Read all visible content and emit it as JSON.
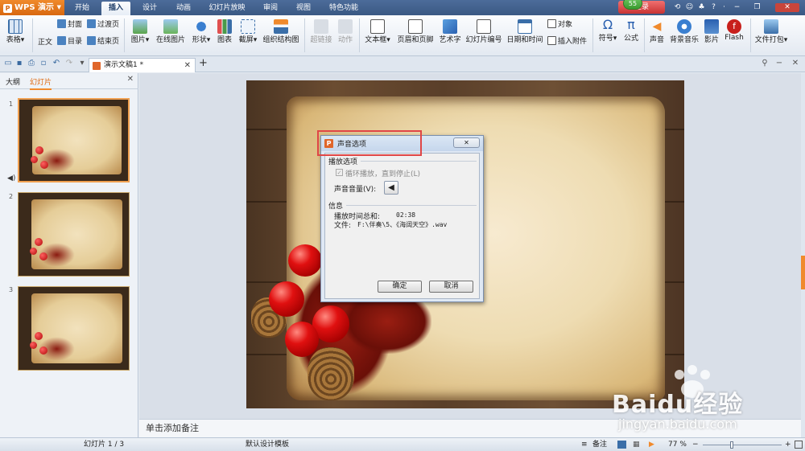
{
  "app": {
    "name": "WPS 演示"
  },
  "tabs": [
    "开始",
    "插入",
    "设计",
    "动画",
    "幻灯片放映",
    "审阅",
    "视图",
    "特色功能"
  ],
  "active_tab": "插入",
  "login": {
    "label": "登录",
    "badge": "55"
  },
  "ribbon": {
    "table": "表格",
    "body": "正文",
    "cover": "封面",
    "catalog": "目录",
    "transition_page": "过渡页",
    "end_page": "结束页",
    "picture": "图片",
    "online_picture": "在线图片",
    "shapes": "形状",
    "chart": "图表",
    "screenshot": "截屏",
    "org_chart": "组织结构图",
    "hyperlink": "超链接",
    "action": "动作",
    "textbox": "文本框",
    "header_footer": "页眉和页脚",
    "wordart": "艺术字",
    "slide_number": "幻灯片编号",
    "datetime": "日期和时间",
    "object": "对象",
    "attachment": "插入附件",
    "symbol": "符号",
    "formula": "公式",
    "sound": "声音",
    "bg_music": "背景音乐",
    "movie": "影片",
    "flash": "Flash",
    "package": "文件打包"
  },
  "doc_tab": {
    "title": "演示文稿1 *"
  },
  "left_panel": {
    "tab_outline": "大纲",
    "tab_slides": "幻灯片",
    "slide_numbers": [
      "1",
      "2",
      "3"
    ]
  },
  "dialog": {
    "title": "声音选项",
    "playback_group": "播放选项",
    "loop_label": "循环播放，直到停止(L)",
    "volume_label": "声音音量(V):",
    "info_group": "信息",
    "duration_label": "播放时间总和:",
    "duration_value": "02:38",
    "file_label": "文件:",
    "file_value": "F:\\伴奏\\5、《海阔天空》.wav",
    "ok": "确定",
    "cancel": "取消"
  },
  "notes_placeholder": "单击添加备注",
  "status": {
    "slide_info": "幻灯片 1 / 3",
    "template": "默认设计模板",
    "notes": "备注",
    "zoom": "77 %"
  },
  "watermark": {
    "brand": "Baidu经验",
    "url": "jingyan.baidu.com"
  },
  "colors": {
    "accent": "#f08a2c",
    "titlebar": "#3a5883",
    "highlight": "#e04646"
  }
}
